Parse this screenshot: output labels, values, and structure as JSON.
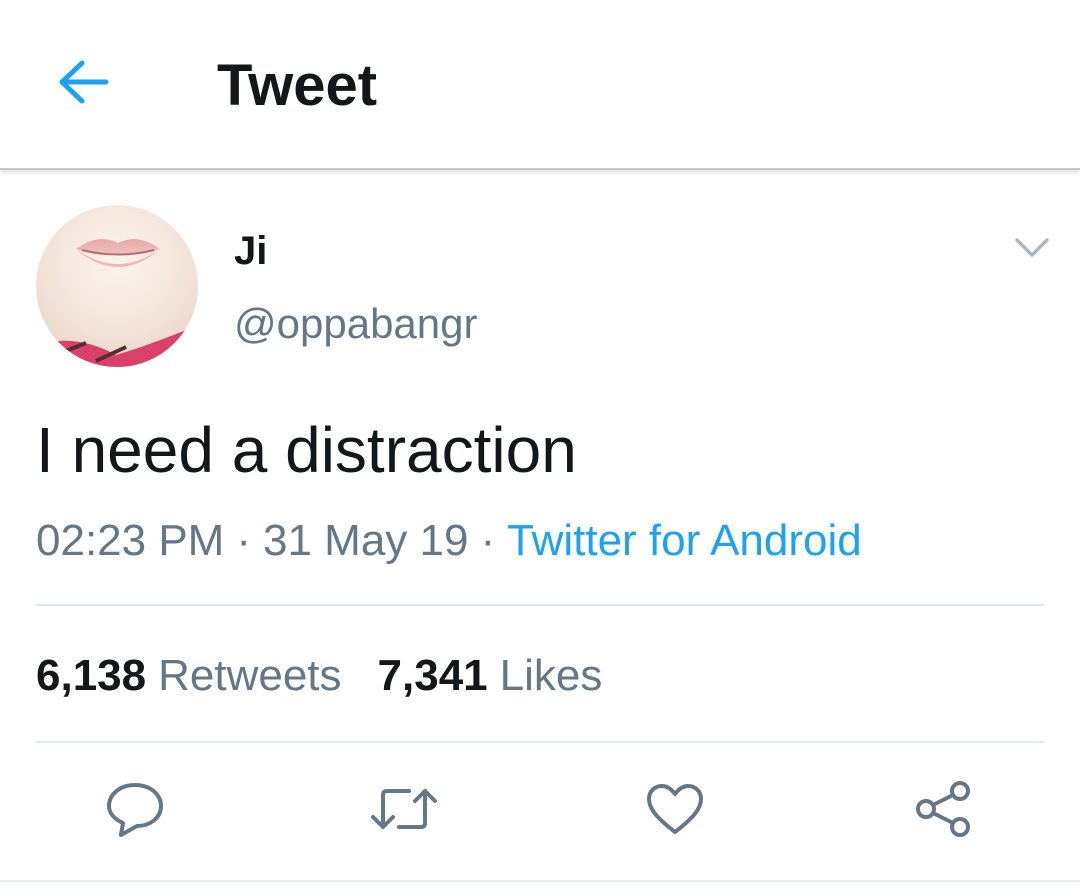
{
  "header": {
    "title": "Tweet",
    "back_icon": "arrow-left-icon",
    "accent_color": "#1da1f2"
  },
  "tweet": {
    "author": {
      "display_name": "Ji",
      "handle": "@oppabangr",
      "avatar": "profile-photo-lips"
    },
    "menu_icon": "chevron-down-icon",
    "text": "I need a distraction",
    "time": "02:23 PM",
    "date": "31 May 19",
    "separator": "·",
    "source": "Twitter for Android",
    "stats": {
      "retweets_count": "6,138",
      "retweets_label": "Retweets",
      "likes_count": "7,341",
      "likes_label": "Likes"
    },
    "actions": [
      {
        "name": "reply",
        "icon": "reply-bubble-icon"
      },
      {
        "name": "retweet",
        "icon": "retweet-icon"
      },
      {
        "name": "like",
        "icon": "heart-icon"
      },
      {
        "name": "share",
        "icon": "share-icon"
      }
    ]
  },
  "colors": {
    "text_primary": "#14171a",
    "text_secondary": "#657786",
    "link": "#1da1f2",
    "divider": "#e1e8ed"
  }
}
